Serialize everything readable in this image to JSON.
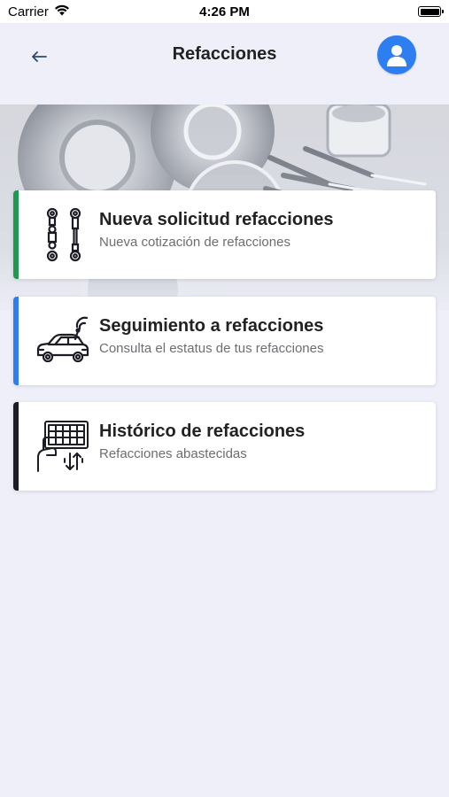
{
  "status": {
    "carrier": "Carrier",
    "time": "4:26 PM"
  },
  "nav": {
    "title": "Refacciones"
  },
  "cards": [
    {
      "title": "Nueva solicitud refacciones",
      "subtitle": "Nueva cotización de refacciones",
      "accent": "#1e9a4f",
      "icon": "suspension-links-icon"
    },
    {
      "title": "Seguimiento a refacciones",
      "subtitle": "Consulta el estatus de tus refacciones",
      "accent": "#2d7ef0",
      "icon": "connected-car-icon"
    },
    {
      "title": "Histórico de refacciones",
      "subtitle": "Refacciones abastecidas",
      "accent": "#1c1c24",
      "icon": "history-grid-icon"
    }
  ],
  "colors": {
    "background": "#eeeff9",
    "avatar": "#2d7ef0"
  }
}
